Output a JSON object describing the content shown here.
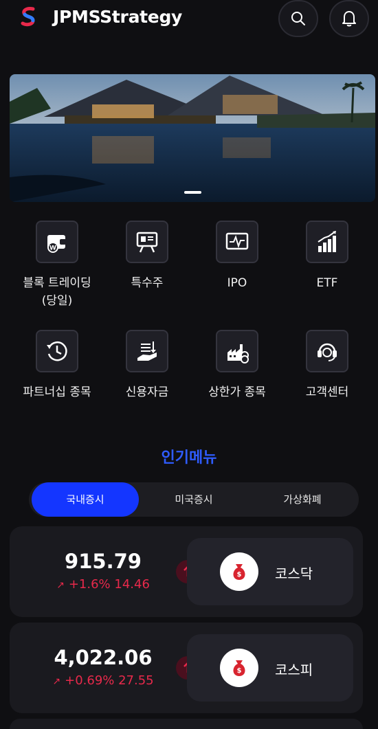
{
  "app": {
    "title": "JPMSStrategy"
  },
  "header": {
    "search_icon": "search-icon",
    "bell_icon": "bell-icon"
  },
  "banner": {
    "image": "waterside-resort-evening",
    "slide_indicator": "1 of 1 visible"
  },
  "quick_menu": [
    {
      "label": "블록 트레이딩\n(당일)",
      "icon": "wallet-icon"
    },
    {
      "label": "특수주",
      "icon": "presentation-board-icon"
    },
    {
      "label": "IPO",
      "icon": "monitor-pulse-icon"
    },
    {
      "label": "ETF",
      "icon": "bar-growth-icon"
    },
    {
      "label": "파트너십 종목",
      "icon": "clock-history-icon"
    },
    {
      "label": "신용자금",
      "icon": "hand-money-icon"
    },
    {
      "label": "상한가 종목",
      "icon": "factory-coin-icon"
    },
    {
      "label": "고객센터",
      "icon": "headset-icon"
    }
  ],
  "popular": {
    "title": "인기메뉴",
    "tabs": [
      {
        "label": "국내증시",
        "active": true
      },
      {
        "label": "미국증시",
        "active": false
      },
      {
        "label": "가상화폐",
        "active": false
      }
    ]
  },
  "markets": [
    {
      "value": "915.79",
      "change": "+1.6% 14.46",
      "name": "코스닥",
      "direction": "up"
    },
    {
      "value": "4,022.06",
      "change": "+0.69% 27.55",
      "name": "코스피",
      "direction": "up"
    }
  ],
  "colors": {
    "accent": "#1436ff",
    "title_blue": "#2f5cff",
    "up_red": "#e8294b",
    "background": "#0f0f12"
  }
}
